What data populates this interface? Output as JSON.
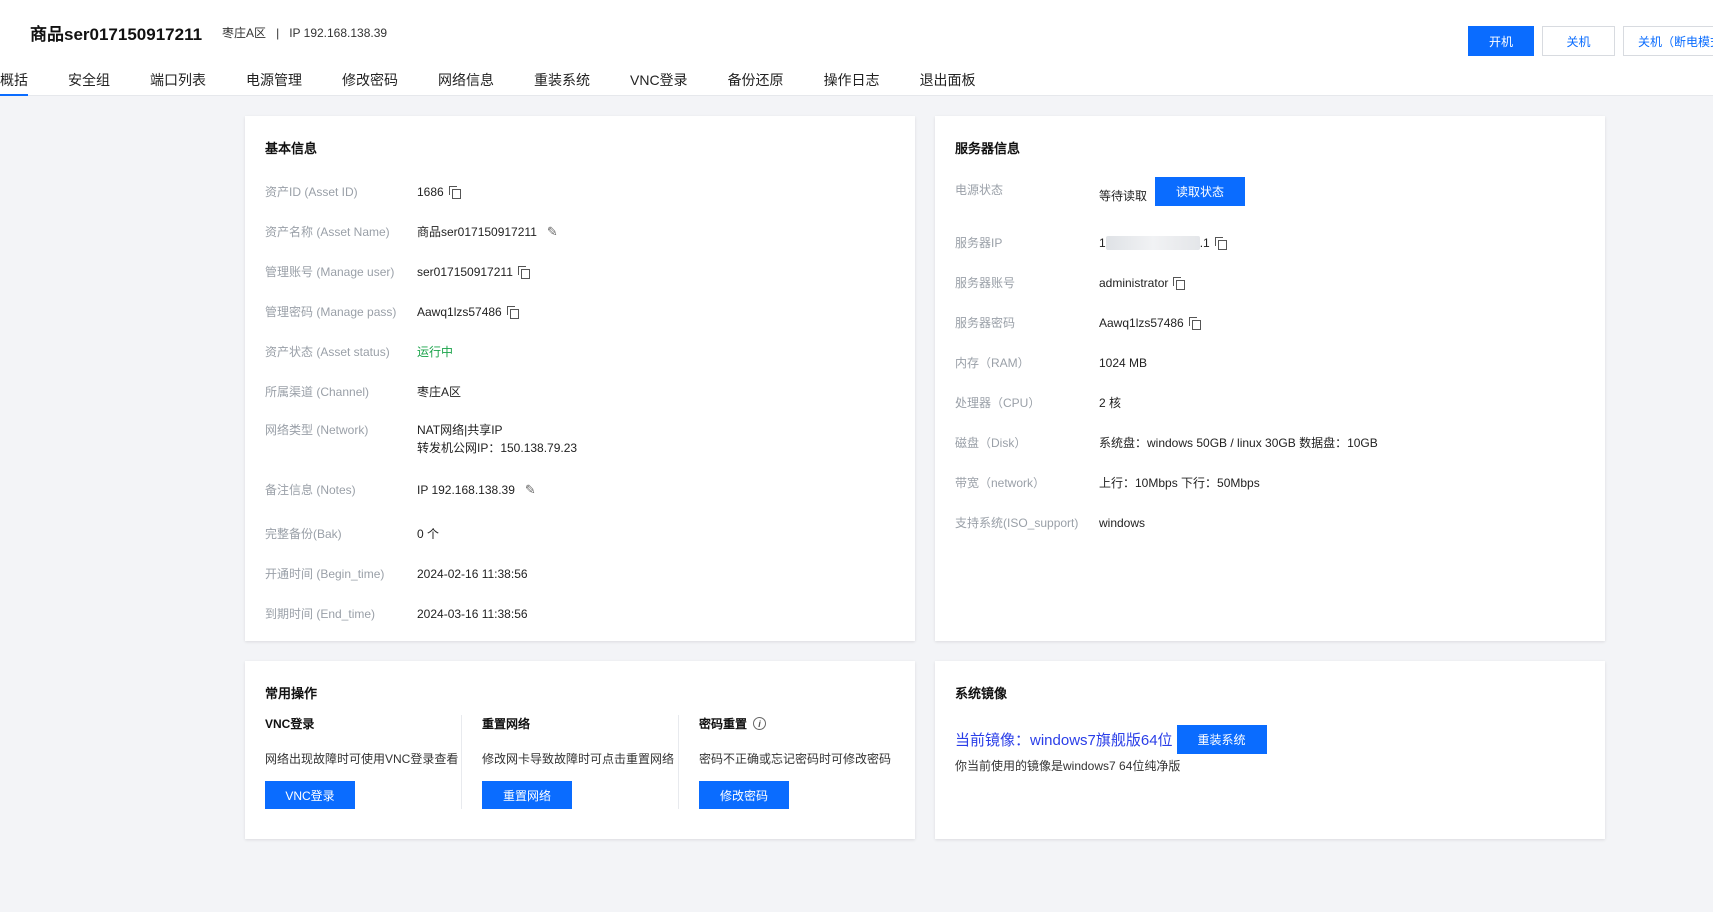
{
  "header": {
    "title": "商品ser017150917211",
    "region": "枣庄A区",
    "separator": "|",
    "ip": "IP 192.168.138.39",
    "buttons": {
      "power_on": "开机",
      "power_off": "关机",
      "power_off_hard": "关机（断电模式）"
    }
  },
  "tabs": [
    "概括",
    "安全组",
    "端口列表",
    "电源管理",
    "修改密码",
    "网络信息",
    "重装系统",
    "VNC登录",
    "备份还原",
    "操作日志",
    "退出面板"
  ],
  "basic_info": {
    "title": "基本信息",
    "rows": [
      {
        "label": "资产ID (Asset ID)",
        "value": "1686"
      },
      {
        "label": "资产名称 (Asset Name)",
        "value": "商品ser017150917211"
      },
      {
        "label": "管理账号 (Manage user)",
        "value": "ser017150917211"
      },
      {
        "label": "管理密码 (Manage pass)",
        "value": "Aawq1lzs57486"
      },
      {
        "label": "资产状态 (Asset status)",
        "value": "运行中"
      },
      {
        "label": "所属渠道 (Channel)",
        "value": "枣庄A区"
      },
      {
        "label": "网络类型 (Network)",
        "value": "NAT网络|共享IP",
        "value2": "转发机公网IP：150.138.79.23"
      },
      {
        "label": "备注信息 (Notes)",
        "value": "IP 192.168.138.39"
      },
      {
        "label": "完整备份(Bak)",
        "value": "0 个"
      },
      {
        "label": "开通时间 (Begin_time)",
        "value": "2024-02-16 11:38:56"
      },
      {
        "label": "到期时间 (End_time)",
        "value": "2024-03-16 11:38:56"
      }
    ]
  },
  "server_info": {
    "title": "服务器信息",
    "power": {
      "label": "电源状态",
      "value": "等待读取",
      "button": "读取状态"
    },
    "ip": {
      "label": "服务器IP",
      "value_prefix": "1",
      "value_suffix": ".1"
    },
    "rows": [
      {
        "label": "服务器账号",
        "value": "administrator"
      },
      {
        "label": "服务器密码",
        "value": "Aawq1lzs57486"
      },
      {
        "label": "内存（RAM）",
        "value": "1024 MB"
      },
      {
        "label": "处理器（CPU）",
        "value": "2 核"
      },
      {
        "label": "磁盘（Disk）",
        "value": "系统盘：windows 50GB / linux 30GB 数据盘：10GB"
      },
      {
        "label": "带宽（network）",
        "value": "上行：10Mbps 下行：50Mbps"
      },
      {
        "label": "支持系统(ISO_support)",
        "value": "windows"
      }
    ]
  },
  "common_ops": {
    "title": "常用操作",
    "items": [
      {
        "title": "VNC登录",
        "desc": "网络出现故障时可使用VNC登录查看",
        "button": "VNC登录"
      },
      {
        "title": "重置网络",
        "desc": "修改网卡导致故障时可点击重置网络",
        "button": "重置网络"
      },
      {
        "title": "密码重置",
        "info": "i",
        "desc": "密码不正确或忘记密码时可修改密码",
        "button": "修改密码"
      }
    ]
  },
  "system_image": {
    "title": "系统镜像",
    "current": "当前镜像：windows7旗舰版64位",
    "button": "重装系统",
    "desc": "你当前使用的镜像是windows7 64位纯净版"
  }
}
